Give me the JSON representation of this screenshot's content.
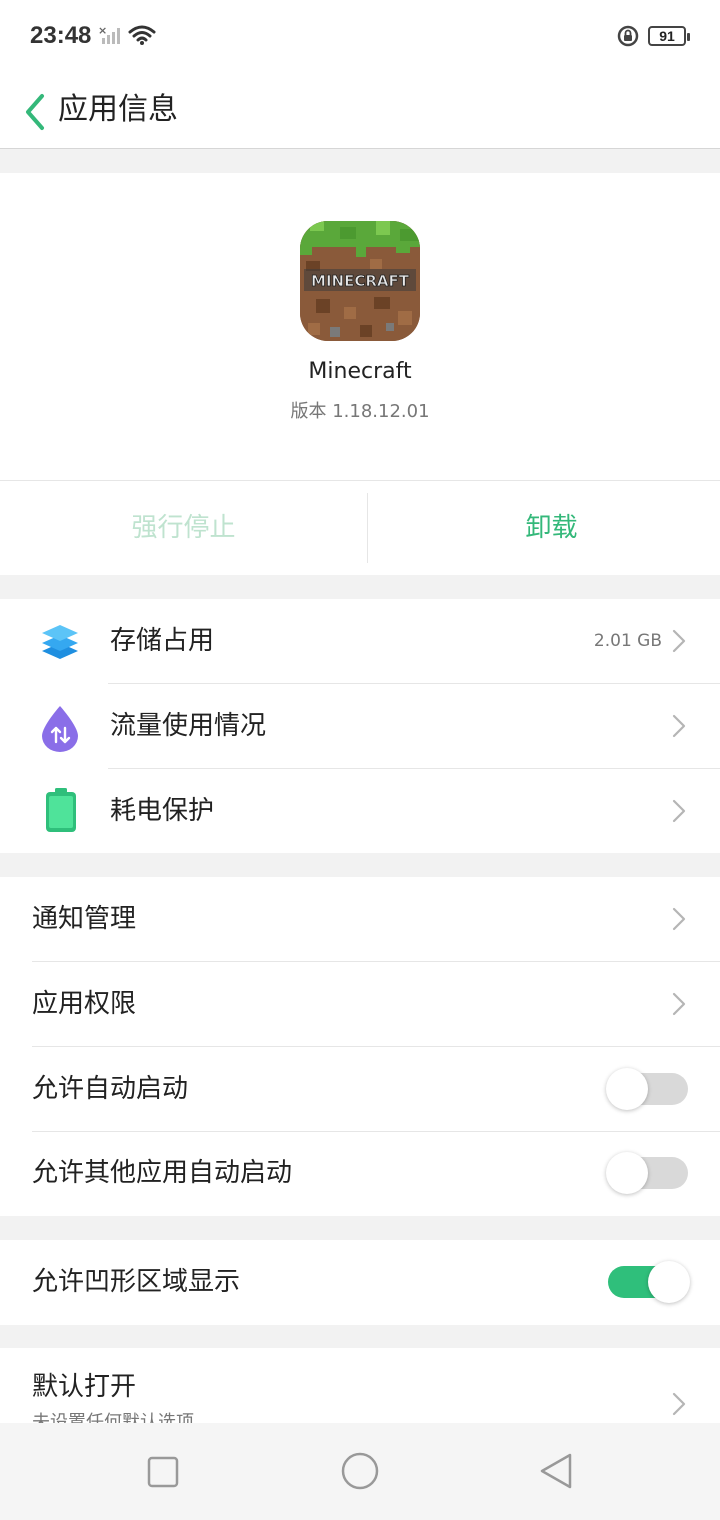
{
  "status": {
    "time": "23:48",
    "battery": "91"
  },
  "header": {
    "title": "应用信息"
  },
  "app": {
    "name": "Minecraft",
    "version": "版本 1.18.12.01",
    "icon_text": "MINECRAFT",
    "force_stop": "强行停止",
    "uninstall": "卸载"
  },
  "usage": {
    "storage": {
      "label": "存储占用",
      "value": "2.01 GB"
    },
    "data": {
      "label": "流量使用情况"
    },
    "battery": {
      "label": "耗电保护"
    }
  },
  "settings": {
    "notifications": "通知管理",
    "permissions": "应用权限",
    "auto_start": "允许自动启动",
    "other_start": "允许其他应用自动启动"
  },
  "notch": {
    "label": "允许凹形区域显示"
  },
  "default": {
    "label": "默认打开",
    "sub": "未设置任何默认选项"
  },
  "colors": {
    "accent": "#2fbf7b",
    "accent_text": "#34b87a",
    "disabled": "#bfe3cf"
  }
}
